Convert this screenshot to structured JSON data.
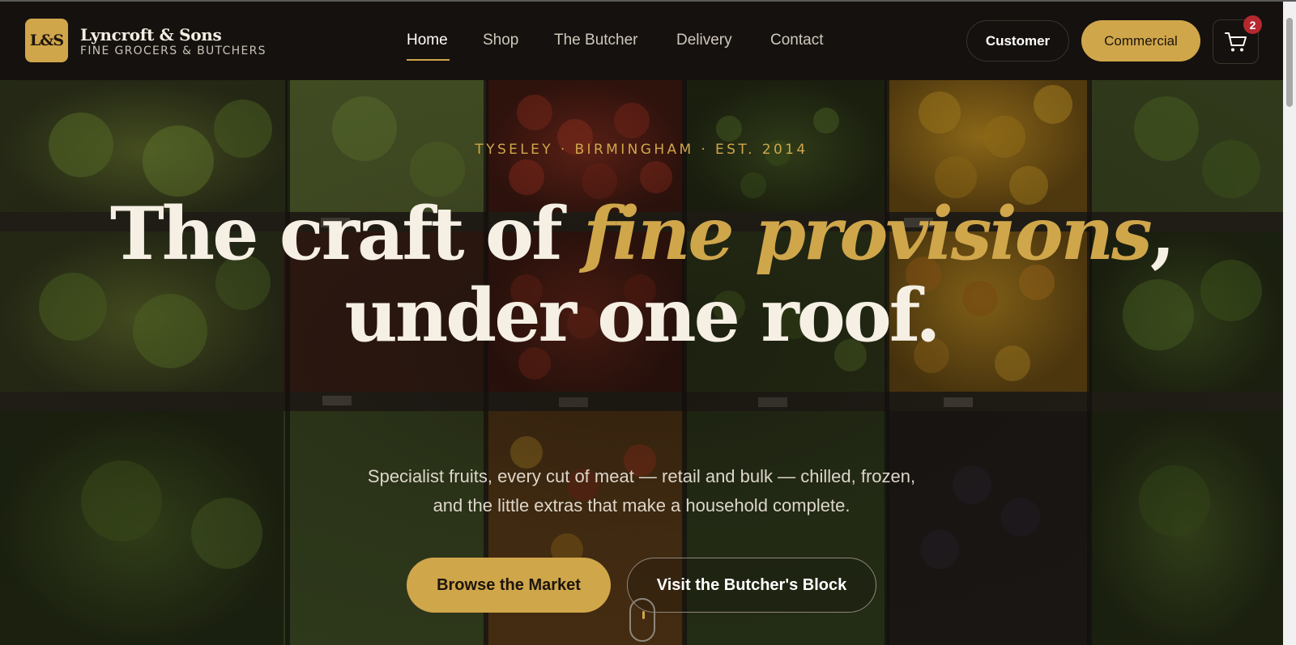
{
  "brand": {
    "logo_text": "L&S",
    "name": "Lyncroft & Sons",
    "tagline": "FINE GROCERS & BUTCHERS"
  },
  "nav": {
    "items": [
      {
        "label": "Home",
        "active": true
      },
      {
        "label": "Shop"
      },
      {
        "label": "The Butcher"
      },
      {
        "label": "Delivery"
      },
      {
        "label": "Contact"
      }
    ]
  },
  "header_actions": {
    "customer_label": "Customer",
    "commercial_label": "Commercial",
    "cart_count": "2"
  },
  "hero": {
    "eyebrow": "TYSELEY · BIRMINGHAM · EST. 2014",
    "headline_part1": "The craft of ",
    "headline_gold": "fine provisions",
    "headline_part2": ", under one roof.",
    "subcopy_line1": "Specialist fruits, every cut of meat — retail and bulk — chilled, frozen,",
    "subcopy_line2": "and the little extras that make a household complete.",
    "cta_primary": "Browse the Market",
    "cta_secondary": "Visit the Butcher's Block"
  },
  "colors": {
    "accent_gold": "#d0a64b",
    "header_bg": "#15110e",
    "badge_red": "#b5282f"
  }
}
